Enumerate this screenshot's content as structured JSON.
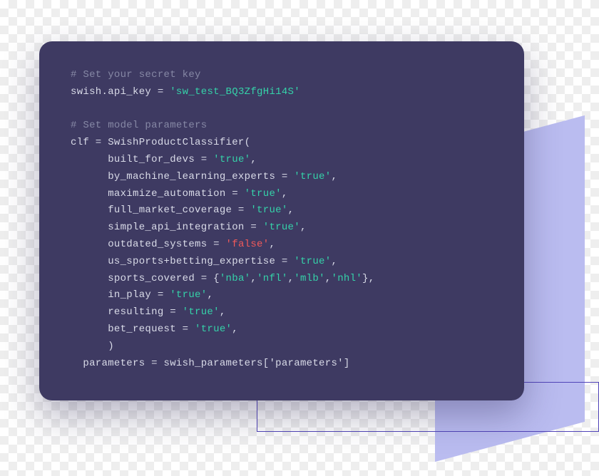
{
  "colors": {
    "card_bg": "#3e3a62",
    "comment": "#8688a5",
    "text": "#d9dbe8",
    "string_true": "#35d2a9",
    "string_false": "#f25a5a",
    "accent_purple": "#babcf0",
    "outline": "#5043b8"
  },
  "tokens": {
    "line1_comment": "# Set your secret key",
    "line2_pre": "swish.api_key = ",
    "line2_str": "'sw_test_BQ3ZfgHi14S'",
    "line3_comment": "# Set model parameters",
    "line4": "clf = SwishProductClassifier(",
    "line5_pre": "      built_for_devs = ",
    "line5_str": "'true'",
    "line5_post": ",",
    "line6_pre": "      by_machine_learning_experts = ",
    "line6_str": "'true'",
    "line6_post": ",",
    "line7_pre": "      maximize_automation = ",
    "line7_str": "'true'",
    "line7_post": ",",
    "line8_pre": "      full_market_coverage = ",
    "line8_str": "'true'",
    "line8_post": ",",
    "line9_pre": "      simple_api_integration = ",
    "line9_str": "'true'",
    "line9_post": ",",
    "line10_pre": "      outdated_systems = ",
    "line10_str": "'false'",
    "line10_post": ",",
    "line11_pre": "      us_sports+betting_expertise = ",
    "line11_str": "'true'",
    "line11_post": ",",
    "line12_pre": "      sports_covered = {",
    "line12_s1": "'nba'",
    "line12_c1": ",",
    "line12_s2": "'nfl'",
    "line12_c2": ",",
    "line12_s3": "'mlb'",
    "line12_c3": ",",
    "line12_s4": "'nhl'",
    "line12_post": "},",
    "line13_pre": "      in_play = ",
    "line13_str": "'true'",
    "line13_post": ",",
    "line14_pre": "      resulting = ",
    "line14_str": "'true'",
    "line14_post": ",",
    "line15_pre": "      bet_request = ",
    "line15_str": "'true'",
    "line15_post": ",",
    "line16": "      )",
    "line17": "  parameters = swish_parameters['parameters']"
  }
}
